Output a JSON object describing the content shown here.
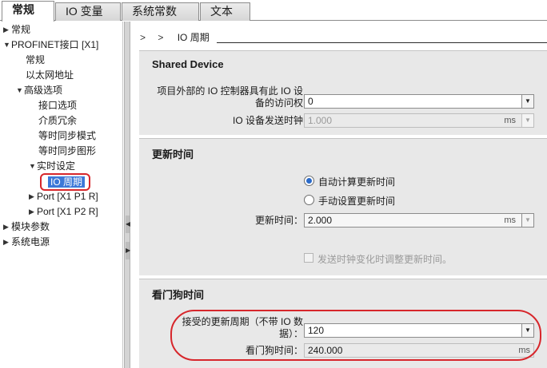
{
  "tabs": [
    {
      "label": "常规",
      "active": true
    },
    {
      "label": "IO 变量",
      "active": false
    },
    {
      "label": "系统常数",
      "active": false
    },
    {
      "label": "文本",
      "active": false
    }
  ],
  "tree": {
    "items": [
      {
        "label": "常规",
        "expander": "collapsed"
      },
      {
        "label": "PROFINET接口 [X1]",
        "expander": "expanded"
      },
      {
        "label": "常规",
        "expander": "none"
      },
      {
        "label": "以太网地址",
        "expander": "none"
      },
      {
        "label": "高级选项",
        "expander": "expanded"
      },
      {
        "label": "接口选项",
        "expander": "none"
      },
      {
        "label": "介质冗余",
        "expander": "none"
      },
      {
        "label": "等时同步模式",
        "expander": "none"
      },
      {
        "label": "等时同步图形",
        "expander": "none"
      },
      {
        "label": "实时设定",
        "expander": "expanded"
      },
      {
        "label": "IO 周期",
        "expander": "none",
        "selected": true
      },
      {
        "label": "Port [X1 P1 R]",
        "expander": "collapsed"
      },
      {
        "label": "Port [X1 P2 R]",
        "expander": "collapsed"
      },
      {
        "label": "模块参数",
        "expander": "collapsed"
      },
      {
        "label": "系统电源",
        "expander": "collapsed"
      }
    ]
  },
  "breadcrumb": {
    "chevrons": "> >",
    "title": "IO 周期"
  },
  "shared_device": {
    "title": "Shared Device",
    "access_label": "项目外部的 IO 控制器具有此 IO 设备的访问权",
    "access_value": "0",
    "send_clock_label": "IO 设备发送时钟",
    "send_clock_value": "1.000",
    "send_clock_unit": "ms"
  },
  "update_time": {
    "title": "更新时间",
    "radio_auto_label": "自动计算更新时间",
    "radio_manual_label": "手动设置更新时间",
    "selected": "auto",
    "update_label": "更新时间：",
    "update_value": "2.000",
    "update_unit": "ms",
    "adjust_label": "发送时钟变化时调整更新时间。",
    "adjust_checked": false
  },
  "watchdog": {
    "title": "看门狗时间",
    "cycles_label": "接受的更新周期（不带 IO 数据）：",
    "cycles_value": "120",
    "time_label": "看门狗时间：",
    "time_value": "240.000",
    "time_unit": "ms"
  },
  "colors": {
    "accent": "#3c78d8",
    "highlight": "#d7262b",
    "panel": "#e8e8e8"
  },
  "icons": {
    "collapsed": "triangle-right-icon",
    "expanded": "triangle-down-icon",
    "dropdown": "chevron-down-icon"
  }
}
